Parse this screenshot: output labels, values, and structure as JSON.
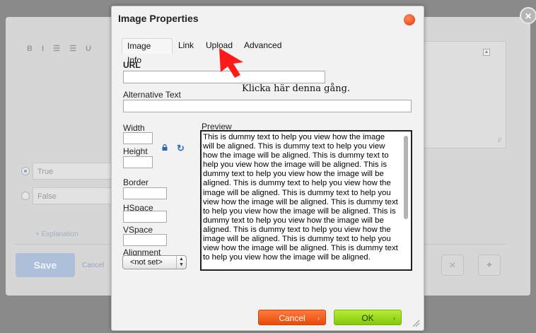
{
  "background": {
    "toolbar_glyphs": [
      "B",
      "I",
      "☰",
      "☰",
      "U"
    ],
    "answers": [
      {
        "label": "True",
        "selected": true
      },
      {
        "label": "False",
        "selected": false
      }
    ],
    "explanation_link": "+ Explanation",
    "save_label": "Save",
    "cancel_label": "Cancel",
    "icon_buttons": [
      "tools-icon",
      "pin-icon"
    ],
    "close_glyph": "×"
  },
  "dialog": {
    "title": "Image Properties",
    "tabs": [
      {
        "label": "Image Info",
        "active": true
      },
      {
        "label": "Link",
        "active": false
      },
      {
        "label": "Upload",
        "active": false
      },
      {
        "label": "Advanced",
        "active": false
      }
    ],
    "url_label": "URL",
    "url_value": "",
    "alt_label": "Alternative Text",
    "alt_value": "",
    "annotation": "Klicka här denna gång.",
    "width_label": "Width",
    "height_label": "Height",
    "border_label": "Border",
    "hspace_label": "HSpace",
    "vspace_label": "VSpace",
    "alignment_label": "Alignment",
    "alignment_value": "<not set>",
    "preview_label": "Preview",
    "preview_text": "This is dummy text to help you view how the image will be aligned. This is dummy text to help you view how the image will be aligned. This is dummy text to help you view how the image will be aligned. This is dummy text to help you view how the image will be aligned. This is dummy text to help you view how the image will be aligned. This is dummy text to help you view how the image will be aligned. This is dummy text to help you view how the image will be aligned. This is dummy text to help you view how the image will be aligned. This is dummy text to help you view how the image will be aligned. This is dummy text to help you view how the image will be aligned. This is dummy text to help you view how the image will be aligned.",
    "cancel_label": "Cancel",
    "ok_label": "OK",
    "colors": {
      "cancel": "#e64b0c",
      "ok": "#86c70e",
      "close": "#e5350a",
      "annotation_arrow": "#ff1a1a"
    }
  }
}
